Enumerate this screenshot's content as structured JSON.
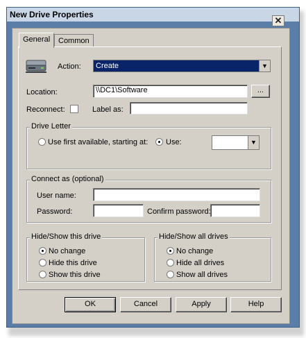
{
  "window": {
    "title": "New Drive Properties",
    "close_glyph": "✕"
  },
  "tabs": [
    {
      "label": "General"
    },
    {
      "label": "Common"
    }
  ],
  "action": {
    "label": "Action:",
    "value": "Create"
  },
  "location": {
    "label": "Location:",
    "value": "\\\\DC1\\Software",
    "browse_label": "..."
  },
  "reconnect": {
    "label": "Reconnect:",
    "checked": false
  },
  "label_as": {
    "label": "Label as:",
    "value": ""
  },
  "drive_letter": {
    "title": "Drive Letter",
    "option_first": "Use first available, starting at:",
    "option_use": "Use:",
    "selected": "use",
    "letter_value": ""
  },
  "connect_as": {
    "title": "Connect as (optional)",
    "username_label": "User name:",
    "username_value": "",
    "password_label": "Password:",
    "password_value": "",
    "confirm_label": "Confirm password:",
    "confirm_value": ""
  },
  "hide_show_drive": {
    "title": "Hide/Show this drive",
    "options": [
      "No change",
      "Hide this drive",
      "Show this drive"
    ],
    "selected_index": 0
  },
  "hide_show_all": {
    "title": "Hide/Show all drives",
    "options": [
      "No change",
      "Hide all drives",
      "Show all drives"
    ],
    "selected_index": 0
  },
  "buttons": {
    "ok": "OK",
    "cancel": "Cancel",
    "apply": "Apply",
    "help": "Help"
  },
  "colors": {
    "selection": "#0a246a",
    "dialog_face": "#d4d0c8",
    "frame": "#5a7ea8"
  },
  "icons": {
    "drive": "network-drive-icon",
    "close": "close-icon",
    "dropdown": "chevron-down-icon"
  }
}
